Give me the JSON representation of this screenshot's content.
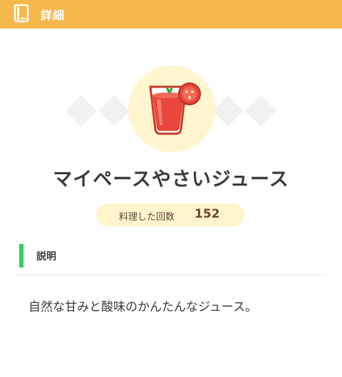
{
  "header": {
    "title": "詳細",
    "icon": "book-icon"
  },
  "item": {
    "name": "マイペースやさいジュース",
    "icon": "tomato-juice-icon",
    "cooked_label": "料理した回数",
    "cooked_count": "152"
  },
  "section": {
    "title": "説明"
  },
  "description": "自然な甘みと酸味のかんたんなジュース。",
  "colors": {
    "header": "#f7b84b",
    "accent_green": "#2fd05c",
    "pill_bg": "#fff4cc",
    "icon_bg": "#fff6cf"
  }
}
